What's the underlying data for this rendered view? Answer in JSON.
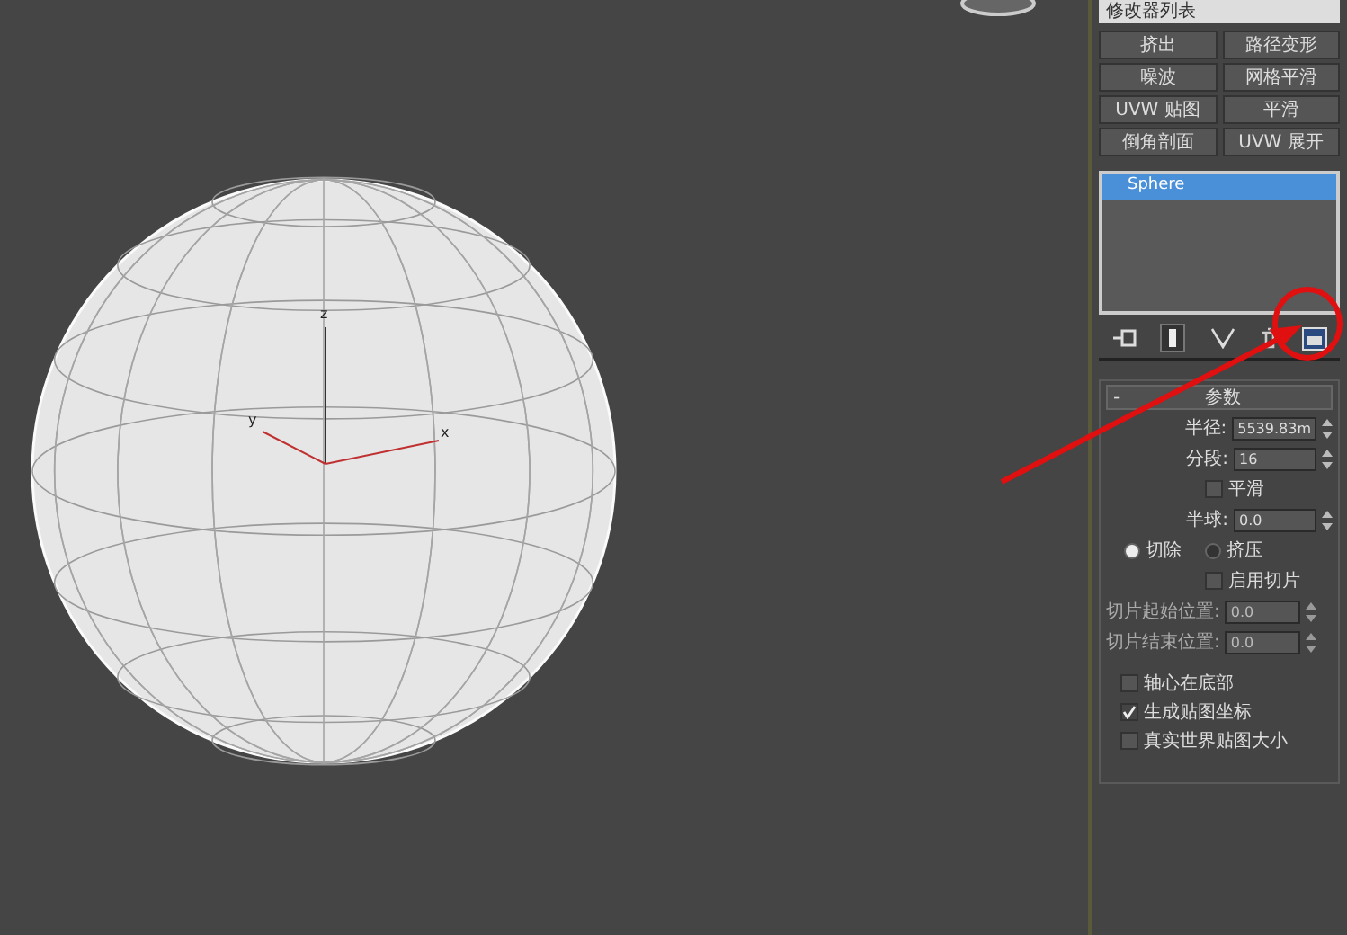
{
  "viewport": {
    "axis_labels": [
      "z",
      "y",
      "x"
    ]
  },
  "modifier_list": {
    "label": "修改器列表"
  },
  "modifier_buttons": [
    "挤出",
    "路径变形",
    "噪波",
    "网格平滑",
    "UVW 贴图",
    "平滑",
    "倒角剖面",
    "UVW 展开"
  ],
  "stack": [
    {
      "label": "Sphere",
      "selected": true
    }
  ],
  "rollout": {
    "collapse": "-",
    "title": "参数"
  },
  "spinners": [
    {
      "label": "半径:",
      "value": "5539.83m"
    },
    {
      "label": "分段:",
      "value": "16"
    }
  ],
  "smooth": {
    "label": "平滑",
    "checked": false
  },
  "hemisphere": {
    "label": "半球:",
    "value": "0.0"
  },
  "modes": [
    {
      "label": "切除",
      "selected": true
    },
    {
      "label": "挤压",
      "selected": false
    }
  ],
  "slice_on": {
    "label": "启用切片",
    "checked": false
  },
  "slice_fields": [
    {
      "label": "切片起始位置:",
      "value": "0.0",
      "disabled": true
    },
    {
      "label": "切片结束位置:",
      "value": "0.0",
      "disabled": true
    }
  ],
  "options": [
    {
      "label": "轴心在底部",
      "checked": false
    },
    {
      "label": "生成贴图坐标",
      "checked": true
    },
    {
      "label": "真实世界贴图大小",
      "checked": false
    }
  ]
}
